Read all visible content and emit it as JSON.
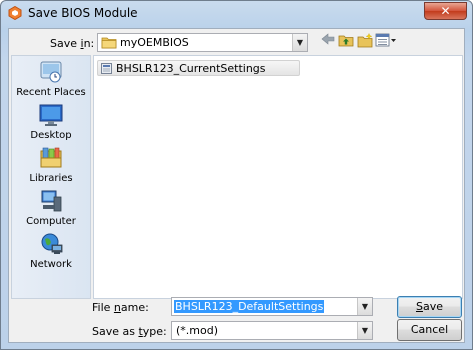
{
  "window": {
    "title": "Save BIOS Module",
    "close_glyph": "✕",
    "app_icon": "hexagon-app-icon"
  },
  "toolbar": {
    "save_in_label": "Save in:",
    "save_in_mnemonic": "i",
    "save_in_value": "myOEMBIOS",
    "back_icon": "back-arrow-icon",
    "up_icon": "up-folder-icon",
    "new_folder_icon": "new-folder-icon",
    "views_icon": "views-menu-icon"
  },
  "places": [
    {
      "label": "Recent Places",
      "icon": "recent-places-icon"
    },
    {
      "label": "Desktop",
      "icon": "desktop-icon"
    },
    {
      "label": "Libraries",
      "icon": "libraries-icon"
    },
    {
      "label": "Computer",
      "icon": "computer-icon"
    },
    {
      "label": "Network",
      "icon": "network-icon"
    }
  ],
  "files": [
    {
      "name": "BHSLR123_CurrentSettings",
      "icon": "file-icon"
    }
  ],
  "bottom": {
    "file_name_label": "File name:",
    "file_name_mnemonic": "n",
    "file_name_value": "BHSLR123_DefaultSettings",
    "save_as_type_label": "Save as type:",
    "save_as_type_mnemonic": "t",
    "save_as_type_value": "(*.mod)",
    "save_button": "Save",
    "cancel_button": "Cancel"
  },
  "colors": {
    "selection": "#3399ff",
    "title_gradient": "#b9d1ea",
    "close_button": "#c23b1c"
  }
}
